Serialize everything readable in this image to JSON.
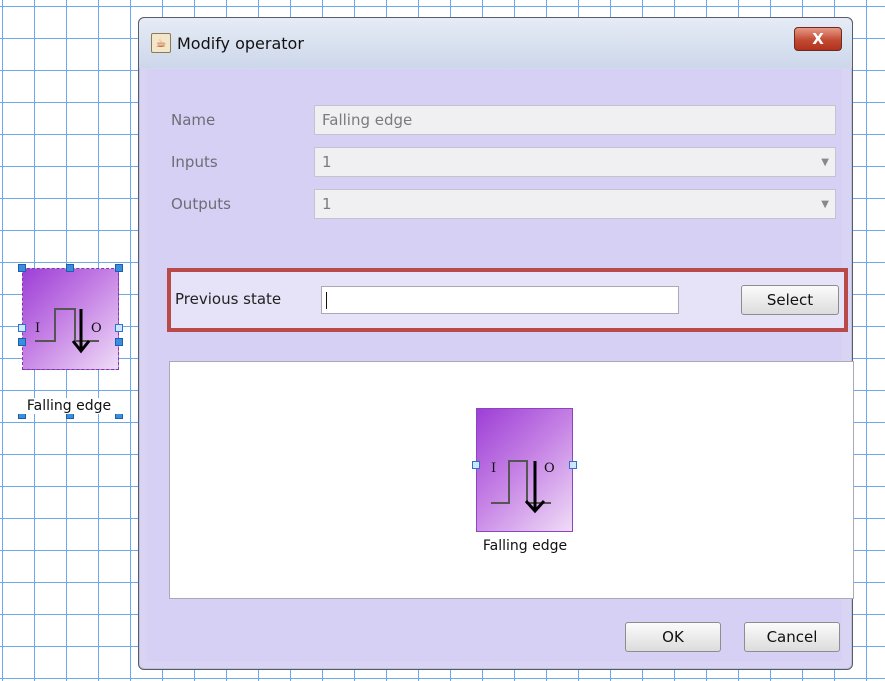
{
  "canvas": {
    "operator": {
      "input_port_letter": "I",
      "output_port_letter": "O",
      "caption": "Falling edge"
    }
  },
  "dialog": {
    "title": "Modify operator",
    "close_label": "X",
    "fields": {
      "name": {
        "label": "Name",
        "value": "Falling edge"
      },
      "inputs": {
        "label": "Inputs",
        "value": "1"
      },
      "outputs": {
        "label": "Outputs",
        "value": "1"
      }
    },
    "previous_state": {
      "label": "Previous state",
      "value": "",
      "select_label": "Select"
    },
    "preview": {
      "input_port_letter": "I",
      "output_port_letter": "O",
      "caption": "Falling edge"
    },
    "ok_label": "OK",
    "cancel_label": "Cancel"
  },
  "colors": {
    "grid_line": "#6fa8e6",
    "dialog_background": "#d6d0f4",
    "operator_gradient_start": "#9d3fd6",
    "highlight_border": "#b84a4a"
  },
  "icons": {
    "app_icon": "java-cup-icon",
    "close_icon": "close-icon",
    "combo_arrow": "chevron-down-icon",
    "operator_symbol": "falling-edge-icon"
  }
}
